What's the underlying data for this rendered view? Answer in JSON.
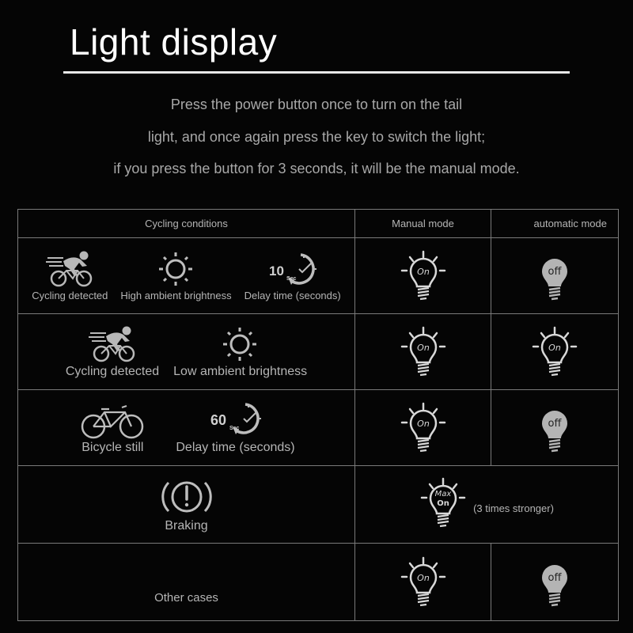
{
  "title": "Light display",
  "intro": [
    "Press the power button once to turn on the tail",
    "light, and once again press the key to switch the light;",
    "if you press the button for 3 seconds, it will be the manual mode."
  ],
  "table": {
    "headers": [
      "Cycling conditions",
      "Manual mode",
      "automatic mode"
    ],
    "rows": [
      {
        "conditions": [
          {
            "icon": "cyclist-icon",
            "label": "Cycling detected"
          },
          {
            "icon": "sun-icon",
            "label": "High ambient brightness"
          },
          {
            "icon": "timer-icon",
            "label": "Delay time (seconds)",
            "timer_value": "10",
            "timer_unit": "Sec"
          }
        ],
        "manual": "On",
        "automatic": "off"
      },
      {
        "conditions": [
          {
            "icon": "cyclist-icon",
            "label": "Cycling detected"
          },
          {
            "icon": "sun-icon",
            "label": "Low ambient brightness"
          }
        ],
        "manual": "On",
        "automatic": "On"
      },
      {
        "conditions": [
          {
            "icon": "bicycle-icon",
            "label": "Bicycle still"
          },
          {
            "icon": "timer-icon",
            "label": "Delay time (seconds)",
            "timer_value": "60",
            "timer_unit": "Sec"
          }
        ],
        "manual": "On",
        "automatic": "off"
      },
      {
        "conditions": [
          {
            "icon": "brake-warning-icon",
            "label": "Braking"
          }
        ],
        "merged_state_top": "Max",
        "merged_state_bottom": "On",
        "merged_note": "(3 times stronger)"
      },
      {
        "conditions": [
          {
            "label": "Other cases"
          }
        ],
        "manual": "On",
        "automatic": "off"
      }
    ]
  }
}
